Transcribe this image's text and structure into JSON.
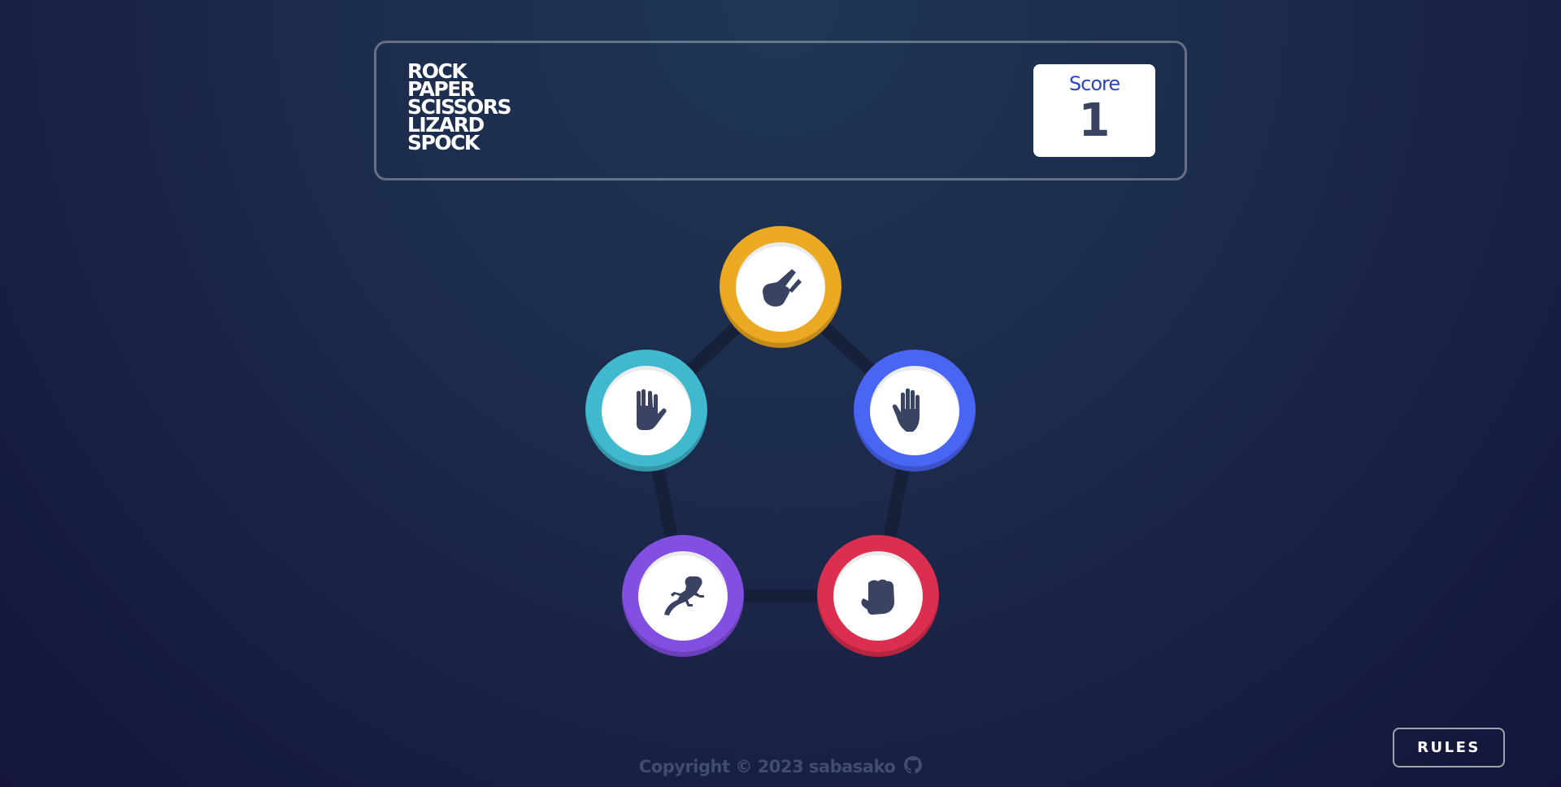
{
  "header": {
    "title_lines": [
      "ROCK",
      "PAPER",
      "SCISSORS",
      "LIZARD",
      "SPOCK"
    ],
    "score_label": "Score",
    "score_value": "1"
  },
  "tokens": [
    {
      "name": "scissors",
      "icon": "scissors-hand-icon",
      "color": "#eca922"
    },
    {
      "name": "paper",
      "icon": "open-hand-icon",
      "color": "#4865f4"
    },
    {
      "name": "rock",
      "icon": "fist-icon",
      "color": "#dc2e4e"
    },
    {
      "name": "lizard",
      "icon": "lizard-icon",
      "color": "#834fe3"
    },
    {
      "name": "spock",
      "icon": "vulcan-salute-icon",
      "color": "#40b9ce"
    }
  ],
  "colors": {
    "connector": "#16203a",
    "icon": "#3b4363",
    "score_label": "#2a46c0"
  },
  "rules_button": {
    "label": "RULES"
  },
  "footer": {
    "text": "Copyright © 2023 sabasako",
    "icon": "github-icon"
  }
}
